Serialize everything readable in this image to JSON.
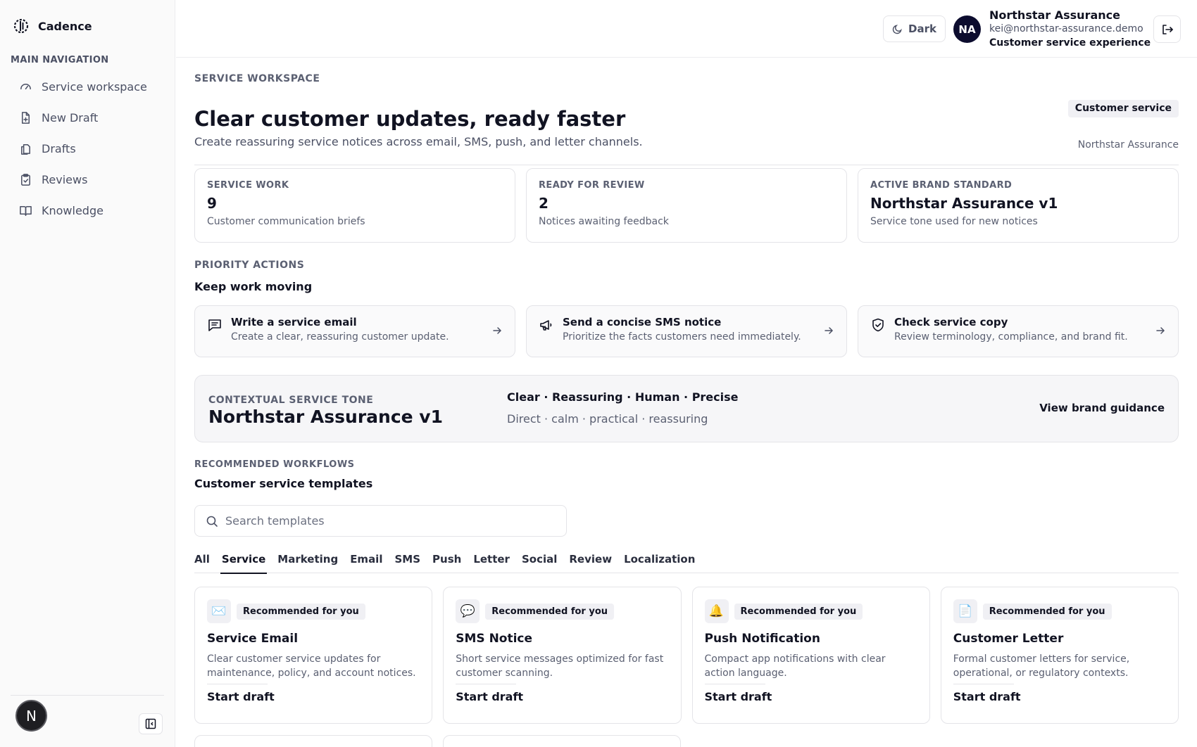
{
  "sidebar": {
    "brand": "Cadence",
    "nav_heading": "MAIN NAVIGATION",
    "items": [
      {
        "label": "Service workspace",
        "icon": "gauge-icon"
      },
      {
        "label": "New Draft",
        "icon": "file-plus-icon"
      },
      {
        "label": "Drafts",
        "icon": "files-icon"
      },
      {
        "label": "Reviews",
        "icon": "clipboard-check-icon"
      },
      {
        "label": "Knowledge",
        "icon": "book-open-icon"
      }
    ],
    "footer_avatar": "N"
  },
  "topbar": {
    "theme_label": "Dark",
    "avatar_initials": "NA",
    "user_name": "Northstar Assurance",
    "user_email": "kei@northstar-assurance.demo",
    "user_role": "Customer service experience"
  },
  "header": {
    "eyebrow": "SERVICE WORKSPACE",
    "title": "Clear customer updates, ready faster",
    "subtitle": "Create reassuring service notices across email, SMS, push, and letter channels.",
    "pill": "Customer service",
    "pill_sub": "Northstar Assurance"
  },
  "stats": [
    {
      "label": "SERVICE WORK",
      "value": "9",
      "desc": "Customer communication briefs"
    },
    {
      "label": "READY FOR REVIEW",
      "value": "2",
      "desc": "Notices awaiting feedback"
    },
    {
      "label": "ACTIVE BRAND STANDARD",
      "value": "Northstar Assurance v1",
      "desc": "Service tone used for new notices"
    }
  ],
  "priority": {
    "eyebrow": "PRIORITY ACTIONS",
    "title": "Keep work moving",
    "actions": [
      {
        "title": "Write a service email",
        "desc": "Create a clear, reassuring customer update."
      },
      {
        "title": "Send a concise SMS notice",
        "desc": "Prioritize the facts customers need immediately."
      },
      {
        "title": "Check service copy",
        "desc": "Review terminology, compliance, and brand fit."
      }
    ]
  },
  "tone": {
    "eyebrow": "CONTEXTUAL SERVICE TONE",
    "name": "Northstar Assurance v1",
    "keywords": "Clear · Reassuring · Human · Precise",
    "traits": "Direct · calm · practical · reassuring",
    "link": "View brand guidance"
  },
  "workflows": {
    "eyebrow": "RECOMMENDED WORKFLOWS",
    "title": "Customer service templates",
    "search_placeholder": "Search templates",
    "tabs": [
      "All",
      "Service",
      "Marketing",
      "Email",
      "SMS",
      "Push",
      "Letter",
      "Social",
      "Review",
      "Localization"
    ],
    "active_tab": "Service",
    "cards": [
      {
        "icon": "✉️",
        "badge": "Recommended for you",
        "title": "Service Email",
        "desc": "Clear customer service updates for maintenance, policy, and account notices.",
        "cta": "Start draft"
      },
      {
        "icon": "💬",
        "badge": "Recommended for you",
        "title": "SMS Notice",
        "desc": "Short service messages optimized for fast customer scanning.",
        "cta": "Start draft"
      },
      {
        "icon": "🔔",
        "badge": "Recommended for you",
        "title": "Push Notification",
        "desc": "Compact app notifications with clear action language.",
        "cta": "Start draft"
      },
      {
        "icon": "📄",
        "badge": "Recommended for you",
        "title": "Customer Letter",
        "desc": "Formal customer letters for service, operational, or regulatory contexts.",
        "cta": "Start draft"
      }
    ]
  }
}
